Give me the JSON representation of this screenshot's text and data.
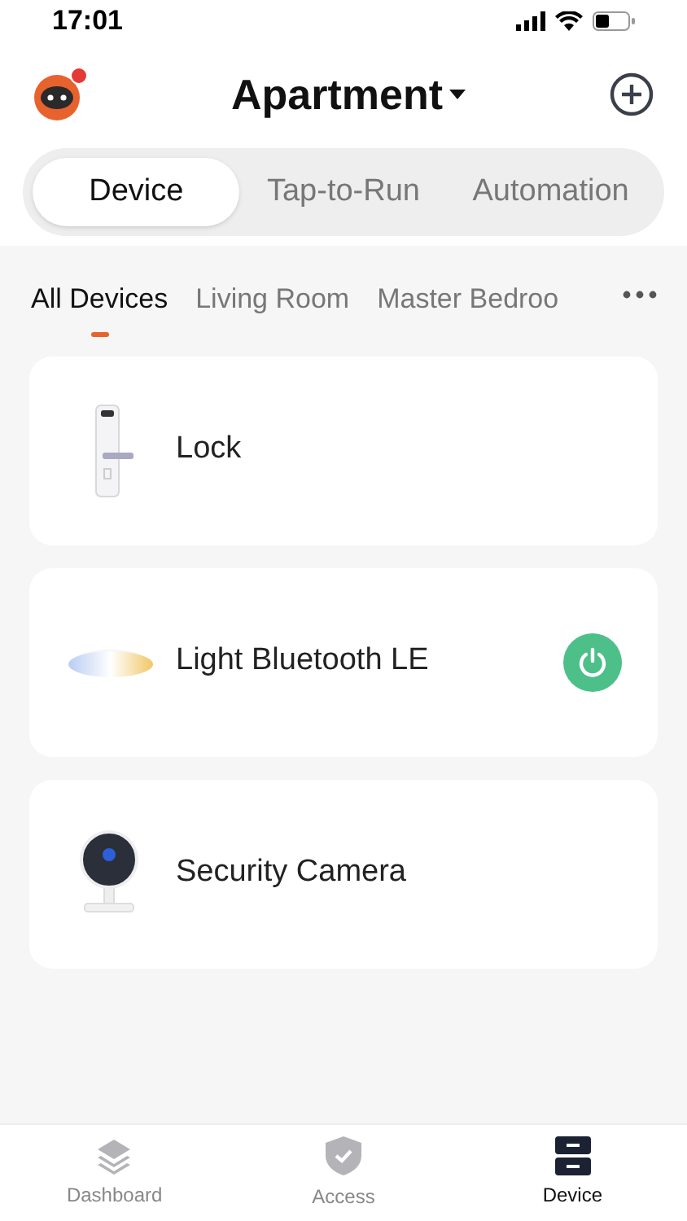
{
  "status_bar": {
    "time": "17:01"
  },
  "header": {
    "title": "Apartment",
    "notification": true
  },
  "tabs": [
    {
      "label": "Device",
      "selected": true
    },
    {
      "label": "Tap-to-Run",
      "selected": false
    },
    {
      "label": "Automation",
      "selected": false
    }
  ],
  "rooms": [
    {
      "label": "All Devices",
      "selected": true
    },
    {
      "label": "Living Room",
      "selected": false
    },
    {
      "label": "Master Bedroo",
      "selected": false
    }
  ],
  "devices": [
    {
      "kind": "lock",
      "name": "Lock"
    },
    {
      "kind": "light",
      "name": "Light Bluetooth LE",
      "on": true
    },
    {
      "kind": "camera",
      "name": "Security Camera"
    }
  ],
  "bottom_nav": [
    {
      "kind": "layers",
      "label": "Dashboard",
      "selected": false
    },
    {
      "kind": "shield",
      "label": "Access",
      "selected": false
    },
    {
      "kind": "device",
      "label": "Device",
      "selected": true
    }
  ]
}
